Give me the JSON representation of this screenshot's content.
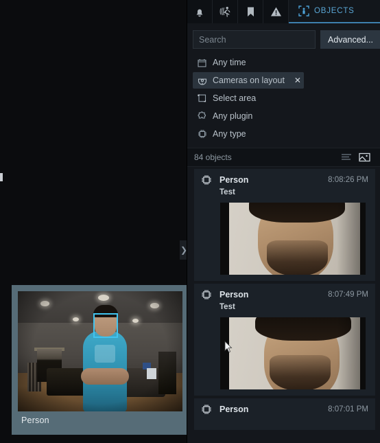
{
  "tabs": [
    {
      "name": "notifications",
      "icon": "bell-icon",
      "label": ""
    },
    {
      "name": "motion",
      "icon": "motion-person-icon",
      "label": ""
    },
    {
      "name": "bookmarks",
      "icon": "bookmark-icon",
      "label": ""
    },
    {
      "name": "events",
      "icon": "warning-triangle-icon",
      "label": ""
    },
    {
      "name": "objects",
      "icon": "person-detect-icon",
      "label": "OBJECTS"
    }
  ],
  "search": {
    "value": "",
    "placeholder": "Search",
    "advanced_label": "Advanced..."
  },
  "filters": [
    {
      "icon": "calendar-icon",
      "label": "Any time",
      "chip": false,
      "close": ""
    },
    {
      "icon": "camera-dome-icon",
      "label": "Cameras on layout",
      "chip": true,
      "close": "✕"
    },
    {
      "icon": "select-area-icon",
      "label": "Select area",
      "chip": false,
      "close": ""
    },
    {
      "icon": "puzzle-plugin-icon",
      "label": "Any plugin",
      "chip": false,
      "close": ""
    },
    {
      "icon": "chip-type-icon",
      "label": "Any type",
      "chip": false,
      "close": ""
    }
  ],
  "results": {
    "count_label": "84 objects",
    "view_list_icon": "list-view-icon",
    "view_thumbnails_icon": "thumbnail-view-icon",
    "active_view": "thumbnails",
    "items": [
      {
        "title": "Person",
        "time": "8:08:26 PM",
        "subtitle": "Test",
        "has_thumb": true
      },
      {
        "title": "Person",
        "time": "8:07:49 PM",
        "subtitle": "Test",
        "has_thumb": true
      },
      {
        "title": "Person",
        "time": "8:07:01 PM",
        "subtitle": "",
        "has_thumb": false
      }
    ]
  },
  "video": {
    "tile_label": "Person",
    "detection_box_color": "#41c4ef",
    "tile_border_color": "#566c77",
    "expander_icon": "chevron-right-icon"
  },
  "colors": {
    "accent": "#3d7fae",
    "tab_active_text": "#5aa7d6",
    "panel_bg": "#14171c",
    "item_bg": "#1b2128",
    "chip_bg": "#2b343d"
  }
}
